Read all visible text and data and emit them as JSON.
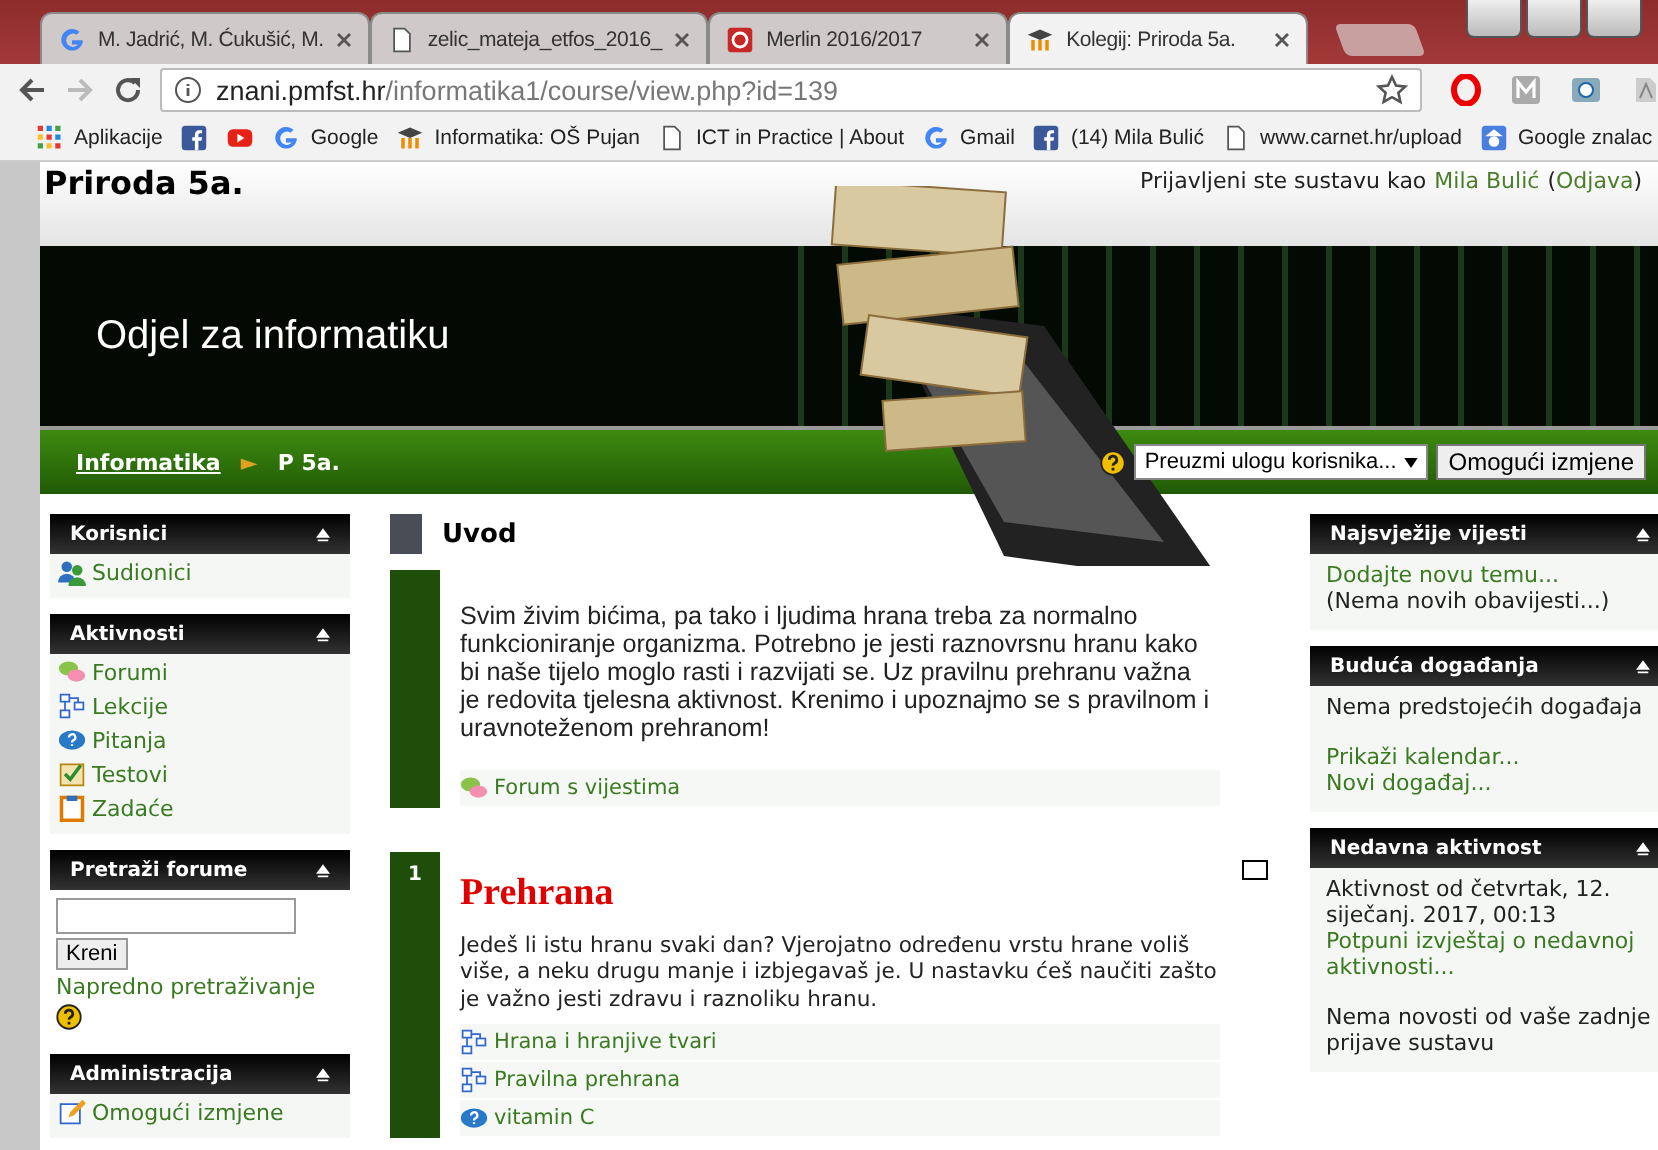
{
  "browser": {
    "tabs": [
      {
        "title": "M. Jadrić, M. Ćukušić, M.",
        "kind": "google",
        "selected": false
      },
      {
        "title": "zelic_mateja_etfos_2016_",
        "kind": "doc",
        "selected": false
      },
      {
        "title": "Merlin 2016/2017",
        "kind": "merlin",
        "selected": false
      },
      {
        "title": "Kolegij: Priroda 5a.",
        "kind": "moodle",
        "selected": true
      }
    ],
    "url": {
      "host": "znani.pmfst.hr",
      "path": "/informatika1/course/view.php?id=139"
    },
    "bookmarks": [
      {
        "label": "Aplikacije",
        "kind": "apps"
      },
      {
        "kind": "facebook"
      },
      {
        "kind": "youtube"
      },
      {
        "label": "Google",
        "kind": "google"
      },
      {
        "label": "Informatika: OŠ Pujan",
        "kind": "moodle"
      },
      {
        "label": "ICT in Practice | About",
        "kind": "doc"
      },
      {
        "label": "Gmail",
        "kind": "google"
      },
      {
        "label": "(14) Mila Bulić",
        "kind": "facebook"
      },
      {
        "label": "www.carnet.hr/upload",
        "kind": "doc"
      },
      {
        "label": "Google znalac",
        "kind": "scholar"
      }
    ]
  },
  "header": {
    "course_title": "Priroda 5a.",
    "login_prefix": "Prijavljeni ste sustavu kao",
    "user": "Mila Bulić",
    "logout_open": "(",
    "logout": "Odjava",
    "logout_close": ")",
    "banner_title": "Odjel za informatiku"
  },
  "breadcrumb": {
    "home": "Informatika",
    "separator": "►",
    "current": "P 5a.",
    "role_select": "Preuzmi ulogu korisnika...",
    "edit_button": "Omogući izmjene"
  },
  "left_blocks": [
    {
      "kind": "links",
      "title": "Korisnici",
      "items": [
        {
          "label": "Sudionici",
          "kind": "people"
        }
      ]
    },
    {
      "kind": "links",
      "title": "Aktivnosti",
      "items": [
        {
          "label": "Forumi",
          "kind": "forum"
        },
        {
          "label": "Lekcije",
          "kind": "lesson"
        },
        {
          "label": "Pitanja",
          "kind": "question"
        },
        {
          "label": "Testovi",
          "kind": "quiz"
        },
        {
          "label": "Zadaće",
          "kind": "assignment"
        }
      ]
    },
    {
      "kind": "search",
      "title": "Pretraži forume",
      "button": "Kreni",
      "link": "Napredno pretraživanje"
    },
    {
      "kind": "links",
      "title": "Administracija",
      "items": [
        {
          "label": "Omogući izmjene",
          "kind": "edit"
        }
      ]
    }
  ],
  "intro": {
    "heading": "Uvod",
    "summary": "Svim živim bićima, pa tako i ljudima hrana treba za normalno funkcioniranje organizma. Potrebno je jesti raznovrsnu hranu kako bi naše tijelo moglo rasti i razvijati se. Uz pravilnu prehranu važna je redovita tjelesna aktivnost. Krenimo i upoznajmo se s pravilnom i uravnoteženom prehranom!",
    "activities": [
      {
        "label": "Forum s vijestima",
        "kind": "forum"
      }
    ]
  },
  "topics": [
    {
      "number": "1",
      "title": "Prehrana",
      "summary": "Jedeš li istu hranu svaki dan? Vjerojatno određenu vrstu hrane voliš više, a neku drugu manje i izbjegavaš je. U nastavku ćeš naučiti zašto je važno jesti zdravu i raznoliku hranu.",
      "activities": [
        {
          "label": "Hrana i hranjive tvari",
          "kind": "lesson"
        },
        {
          "label": "Pravilna prehrana",
          "kind": "lesson"
        },
        {
          "label": "vitamin C",
          "kind": "question"
        }
      ]
    }
  ],
  "right_blocks": [
    {
      "title": "Najsvježije vijesti",
      "groups": [
        [
          {
            "text": "Dodajte novu temu...",
            "kind": "link"
          },
          {
            "text": "(Nema novih obavijesti...)",
            "kind": "text"
          }
        ]
      ]
    },
    {
      "title": "Buduća događanja",
      "groups": [
        [
          {
            "text": "Nema predstojećih događaja",
            "kind": "text"
          }
        ],
        [
          {
            "text": "Prikaži kalendar...",
            "kind": "link"
          },
          {
            "text": "Novi događaj...",
            "kind": "link"
          }
        ]
      ]
    },
    {
      "title": "Nedavna aktivnost",
      "groups": [
        [
          {
            "text": "Aktivnost od četvrtak, 12. siječanj. 2017, 00:13",
            "kind": "text"
          },
          {
            "text": "Potpuni izvještaj o nedavnoj aktivnosti...",
            "kind": "link"
          }
        ],
        [
          {
            "text": "Nema novosti od vaše zadnje prijave sustavu",
            "kind": "text"
          }
        ]
      ]
    }
  ]
}
